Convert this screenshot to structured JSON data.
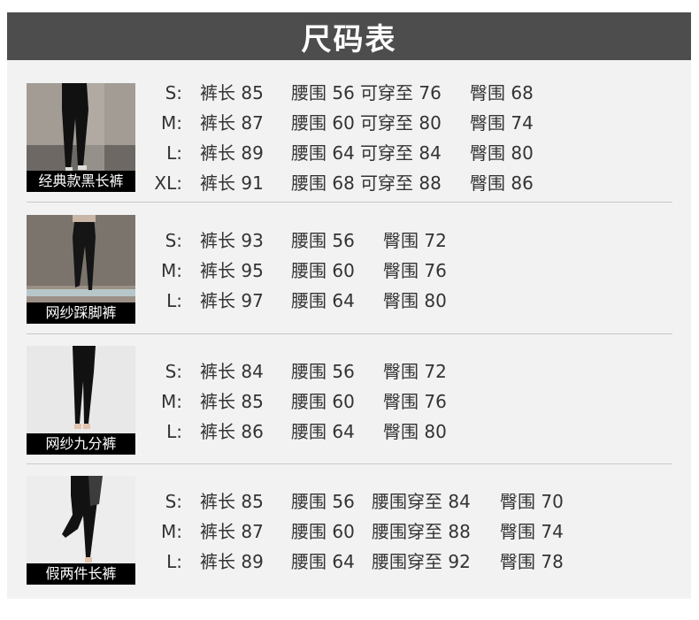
{
  "title": "尺码表",
  "products": [
    {
      "name": "经典款黑长裤",
      "rows": [
        {
          "size": "S:",
          "length": "裤长 85",
          "waist": "腰围 56",
          "extra": "可穿至 76",
          "hip": "臀围 68"
        },
        {
          "size": "M:",
          "length": "裤长 87",
          "waist": "腰围 60",
          "extra": "可穿至 80",
          "hip": "臀围 74"
        },
        {
          "size": "L:",
          "length": "裤长 89",
          "waist": "腰围 64",
          "extra": "可穿至 84",
          "hip": "臀围 80"
        },
        {
          "size": "XL:",
          "length": "裤长 91",
          "waist": "腰围 68",
          "extra": "可穿至 88",
          "hip": "臀围 86"
        }
      ]
    },
    {
      "name": "网纱踩脚裤",
      "rows": [
        {
          "size": "S:",
          "length": "裤长 93",
          "waist": "腰围 56",
          "hip": "臀围 72"
        },
        {
          "size": "M:",
          "length": "裤长 95",
          "waist": "腰围 60",
          "hip": "臀围 76"
        },
        {
          "size": "L:",
          "length": "裤长 97",
          "waist": "腰围 64",
          "hip": "臀围 80"
        }
      ]
    },
    {
      "name": "网纱九分裤",
      "rows": [
        {
          "size": "S:",
          "length": "裤长 84",
          "waist": "腰围 56",
          "hip": "臀围 72"
        },
        {
          "size": "M:",
          "length": "裤长 85",
          "waist": "腰围 60",
          "hip": "臀围 76"
        },
        {
          "size": "L:",
          "length": "裤长 86",
          "waist": "腰围 64",
          "hip": "臀围 80"
        }
      ]
    },
    {
      "name": "假两件长裤",
      "rows": [
        {
          "size": "S:",
          "length": "裤长 85",
          "waist": "腰围 56",
          "extra": "腰围穿至 84",
          "hip": "臀围 70"
        },
        {
          "size": "M:",
          "length": "裤长 87",
          "waist": "腰围 60",
          "extra": "腰围穿至 88",
          "hip": "臀围 74"
        },
        {
          "size": "L:",
          "length": "裤长 89",
          "waist": "腰围 64",
          "extra": "腰围穿至 92",
          "hip": "臀围 78"
        }
      ]
    }
  ]
}
